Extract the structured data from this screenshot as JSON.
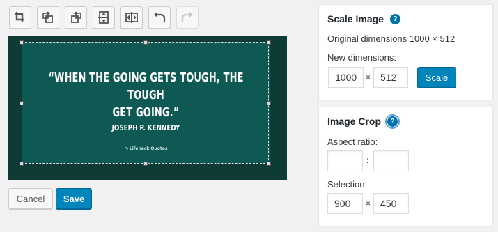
{
  "toolbar": {
    "buttons": [
      {
        "icon": "crop-icon"
      },
      {
        "icon": "rotate-left-icon"
      },
      {
        "icon": "rotate-right-icon"
      },
      {
        "icon": "flip-vertical-icon"
      },
      {
        "icon": "flip-horizontal-icon"
      },
      {
        "icon": "undo-icon"
      },
      {
        "icon": "redo-icon",
        "disabled": true
      }
    ]
  },
  "image": {
    "quote_line1": "“WHEN THE GOING GETS TOUGH, THE TOUGH",
    "quote_line2": "GET GOING.”",
    "author": "JOSEPH P. KENNEDY",
    "brand": "Lifehack Quotes"
  },
  "actions": {
    "cancel_label": "Cancel",
    "save_label": "Save"
  },
  "scale_panel": {
    "title": "Scale Image",
    "help_icon": "?",
    "original_dimensions": "Original dimensions 1000 × 512",
    "new_dimensions_label": "New dimensions:",
    "width_value": "1000",
    "height_value": "512",
    "times": "×",
    "scale_label": "Scale"
  },
  "crop_panel": {
    "title": "Image Crop",
    "help_icon": "?",
    "aspect_ratio_label": "Aspect ratio:",
    "aspect_width_value": "",
    "aspect_height_value": "",
    "aspect_sep": ":",
    "selection_label": "Selection:",
    "selection_width_value": "900",
    "selection_height_value": "450",
    "times": "×"
  },
  "colors": {
    "primary": "#0085ba",
    "image_bg": "#0e5954",
    "image_outer": "#0f3b37"
  }
}
